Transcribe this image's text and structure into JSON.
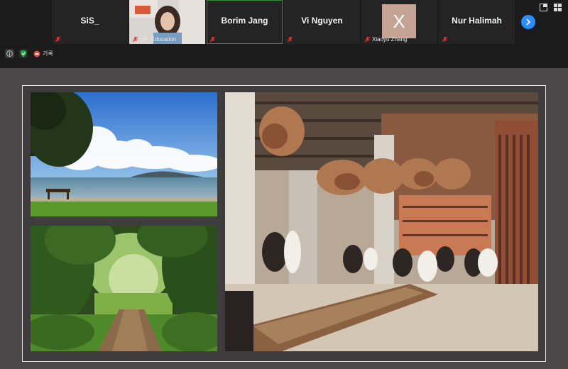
{
  "participants": [
    {
      "name": "SiS_",
      "label": "",
      "type": "name",
      "muted": true
    },
    {
      "name": "",
      "label": "UP_Education",
      "type": "video",
      "muted": true
    },
    {
      "name": "Borim Jang",
      "label": "",
      "type": "name",
      "muted": true,
      "active": true
    },
    {
      "name": "Vi Nguyen",
      "label": "",
      "type": "name",
      "muted": true
    },
    {
      "name": "",
      "label": "Xiaoyu Zhang",
      "type": "avatar",
      "avatar_letter": "X",
      "muted": true
    },
    {
      "name": "Nur Halimah",
      "label": "",
      "type": "name",
      "muted": true
    }
  ],
  "controls": {
    "next_icon": "chevron-right-icon",
    "top_right_icons": [
      "share-window-icon",
      "grid-view-icon"
    ]
  },
  "status": {
    "info_icon": "info-icon",
    "security_icon": "shield-check-icon",
    "recording_icon": "record-icon",
    "recording_label": "기록"
  },
  "shared_screen": {
    "photos": [
      {
        "name": "beach-photo",
        "scene": "seaside park with bench and island"
      },
      {
        "name": "forest-path-photo",
        "scene": "forest trail"
      },
      {
        "name": "restaurant-photo",
        "scene": "restaurant interior with hanging dried flowers"
      }
    ]
  },
  "colors": {
    "accent": "#2d8cff",
    "active_border": "#3b8a3b",
    "avatar_bg": "#c4a394",
    "security_green": "#22a447",
    "record_red": "#e0433a"
  }
}
